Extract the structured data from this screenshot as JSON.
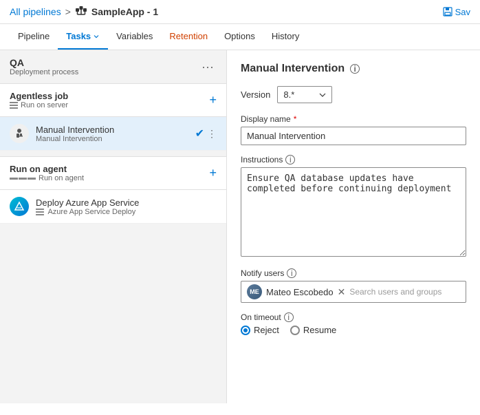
{
  "header": {
    "breadcrumb_link": "All pipelines",
    "sep": ">",
    "pipeline_name": "SampleApp - 1",
    "save_label": "Sav"
  },
  "nav": {
    "tabs": [
      {
        "id": "pipeline",
        "label": "Pipeline",
        "active": false,
        "orange": false
      },
      {
        "id": "tasks",
        "label": "Tasks",
        "active": true,
        "orange": false,
        "has_arrow": true
      },
      {
        "id": "variables",
        "label": "Variables",
        "active": false,
        "orange": false
      },
      {
        "id": "retention",
        "label": "Retention",
        "active": false,
        "orange": true
      },
      {
        "id": "options",
        "label": "Options",
        "active": false,
        "orange": false
      },
      {
        "id": "history",
        "label": "History",
        "active": false,
        "orange": false
      }
    ]
  },
  "left_panel": {
    "stage_title": "QA",
    "stage_subtitle": "Deployment process",
    "agentless_job": {
      "title": "Agentless job",
      "subtitle": "Run on server"
    },
    "manual_intervention": {
      "name": "Manual Intervention",
      "subtitle": "Manual Intervention",
      "selected": true
    },
    "run_on_agent": {
      "title": "Run on agent",
      "subtitle": "Run on agent"
    },
    "deploy_task": {
      "name": "Deploy Azure App Service",
      "subtitle": "Azure App Service Deploy"
    }
  },
  "right_panel": {
    "title": "Manual Intervention",
    "version_label": "Version",
    "version_value": "8.*",
    "display_name_label": "Display name",
    "required_marker": "*",
    "display_name_value": "Manual Intervention",
    "instructions_label": "Instructions",
    "instructions_value": "Ensure QA database updates have completed before continuing deployment",
    "notify_users_label": "Notify users",
    "user_name": "Mateo Escobedo",
    "search_placeholder": "Search users and groups",
    "on_timeout_label": "On timeout",
    "reject_label": "Reject",
    "resume_label": "Resume"
  }
}
